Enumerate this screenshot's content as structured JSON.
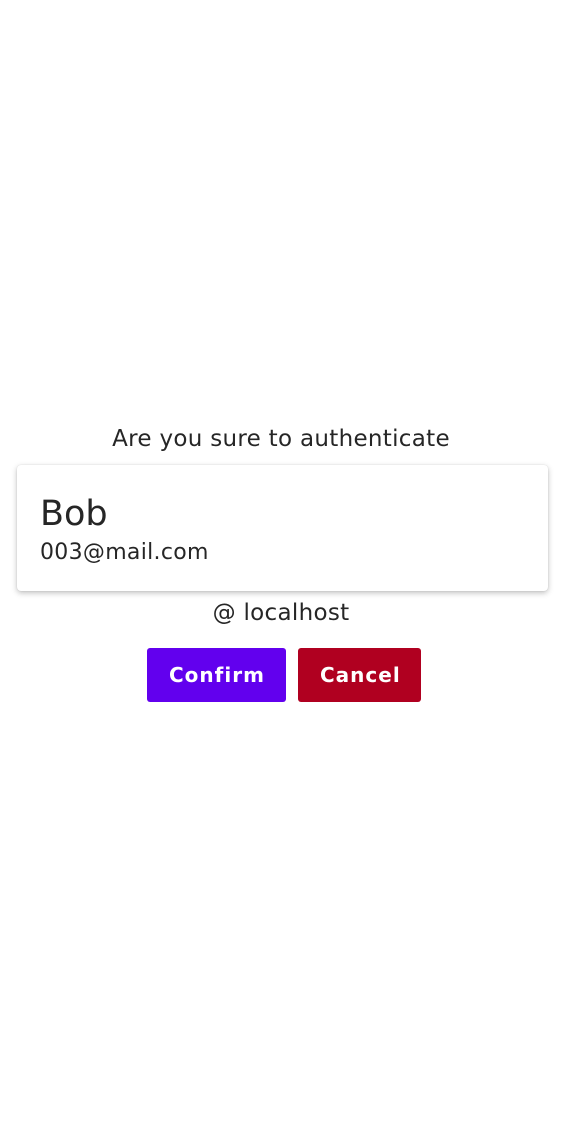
{
  "dialog": {
    "prompt": "Are you sure to authenticate",
    "user": {
      "name": "Bob",
      "email": "003@mail.com"
    },
    "host": "@ localhost",
    "confirm_label": "Confirm",
    "cancel_label": "Cancel"
  },
  "colors": {
    "confirm": "#6200ee",
    "cancel": "#b00020",
    "text": "#262626",
    "background": "#ffffff"
  }
}
